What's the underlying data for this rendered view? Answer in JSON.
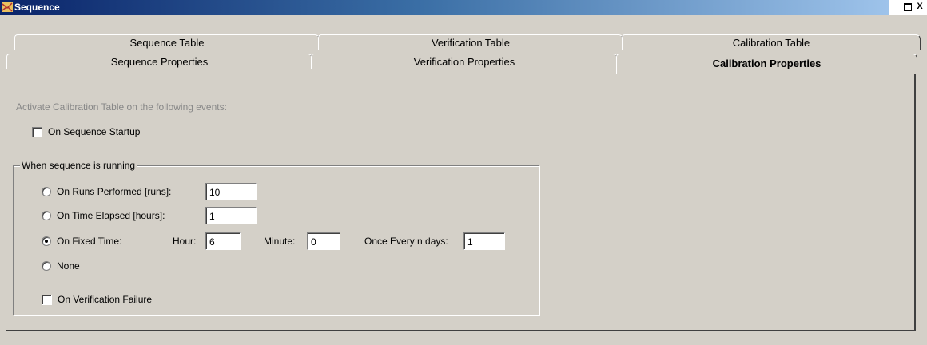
{
  "window": {
    "title": "Sequence",
    "minimize": "_",
    "close": "X"
  },
  "tabs_row1": [
    "Sequence Table",
    "Verification Table",
    "Calibration Table"
  ],
  "tabs_row2": [
    "Sequence Properties",
    "Verification Properties",
    "Calibration Properties"
  ],
  "active_tab": "Calibration Properties",
  "activate_label": "Activate Calibration Table on the following events:",
  "on_startup": {
    "label": "On Sequence Startup",
    "checked": false
  },
  "group": {
    "legend": "When sequence is running",
    "runs": {
      "label": "On Runs Performed [runs]:",
      "value": "10",
      "selected": false
    },
    "time": {
      "label": "On Time Elapsed [hours]:",
      "value": "1",
      "selected": false
    },
    "fixed": {
      "label": "On Fixed Time:",
      "selected": true,
      "hour_label": "Hour:",
      "hour": "6",
      "minute_label": "Minute:",
      "minute": "0",
      "days_label": "Once Every n days:",
      "days": "1"
    },
    "none": {
      "label": "None",
      "selected": false
    },
    "verification_failure": {
      "label": "On Verification Failure",
      "checked": false
    }
  }
}
